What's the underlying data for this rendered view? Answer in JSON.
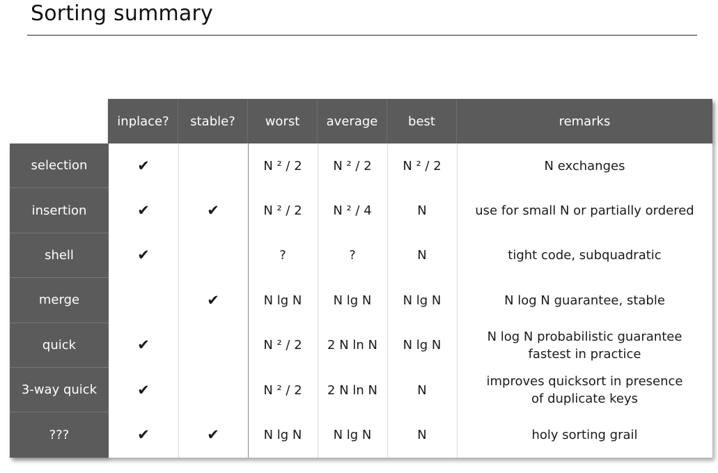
{
  "title": "Sorting summary",
  "headers": [
    "inplace?",
    "stable?",
    "worst",
    "average",
    "best",
    "remarks"
  ],
  "check_symbol": "✔",
  "rows": [
    {
      "name": "selection",
      "inplace": "✔",
      "stable": "",
      "worst": "N ² / 2",
      "average": "N ² / 2",
      "best": "N ² / 2",
      "remark_lines": [
        "N exchanges"
      ]
    },
    {
      "name": "insertion",
      "inplace": "✔",
      "stable": "✔",
      "worst": "N ² / 2",
      "average": "N ² / 4",
      "best": "N",
      "remark_lines": [
        "use for small N or partially ordered"
      ]
    },
    {
      "name": "shell",
      "inplace": "✔",
      "stable": "",
      "worst": "?",
      "average": "?",
      "best": "N",
      "remark_lines": [
        "tight code, subquadratic"
      ]
    },
    {
      "name": "merge",
      "inplace": "",
      "stable": "✔",
      "worst": "N lg N",
      "average": "N lg N",
      "best": "N lg N",
      "remark_lines": [
        "N log N  guarantee, stable"
      ]
    },
    {
      "name": "quick",
      "inplace": "✔",
      "stable": "",
      "worst": "N ² / 2",
      "average": "2 N ln N",
      "best": "N lg N",
      "remark_lines": [
        "N log N  probabilistic guarantee",
        "fastest in practice"
      ]
    },
    {
      "name": "3-way quick",
      "inplace": "✔",
      "stable": "",
      "worst": "N ² / 2",
      "average": "2 N ln N",
      "best": "N",
      "remark_lines": [
        "improves quicksort in presence",
        "of duplicate keys"
      ]
    },
    {
      "name": "???",
      "inplace": "✔",
      "stable": "✔",
      "worst": "N lg N",
      "average": "N lg N",
      "best": "N",
      "remark_lines": [
        "holy sorting grail"
      ]
    }
  ]
}
